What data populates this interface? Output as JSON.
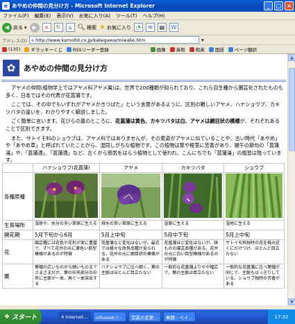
{
  "window": {
    "title": "あやめの仲間の見分け方 - Microsoft Internet Explorer"
  },
  "menu": [
    "ファイル(F)",
    "編集(E)",
    "表示(V)",
    "お気に入り(A)",
    "ツール(T)",
    "ヘルプ(H)"
  ],
  "toolbar": {
    "back": "戻る",
    "search": "検索",
    "favorites": "お気に入り"
  },
  "address": {
    "label": "アドレス(D)",
    "url": "http://www.kamoltd.co.jp/kakegawa/miwake.htm"
  },
  "links": [
    {
      "label": "(135)",
      "color": "#c23434"
    },
    {
      "label": "ギラッキーくじ",
      "color": "#e6a51a"
    },
    {
      "label": "RSSリーダー登録",
      "color": "#3e7ed6"
    },
    {
      "label": "画像",
      "color": "#4d8d3a"
    },
    {
      "label": "英和",
      "color": "#c23434"
    },
    {
      "label": "和英",
      "color": "#c23434"
    },
    {
      "label": "国語",
      "color": "#3e7ed6"
    },
    {
      "label": "ページ翻訳",
      "color": "#3e7ed6"
    }
  ],
  "page": {
    "title": "あやめの仲間の見分け方",
    "p1": "アヤメの仲間(植物学上ではアヤメ科アヤメ属)は、世界で200種類が知られており、これら自生種から園芸化されたものも多く、日本ではその代表が花菖蒲です。",
    "p2": "ここでは、その中でもいずれがアヤメかきつばた」という言葉があるように、区別の難しいアヤメ、ハナショウブ、カキツバタの違いを、わかりやすく解説しました。",
    "p3a": "ごく簡単に言います。花びらの基のところに、",
    "p3b": "花菖蒲は黄色、カキツバタは白、アヤメは網目状の模様",
    "p3c": "が、それぞれあることで区別できます。",
    "p4": "また、サトイモ科のショウブは、アヤメ科ではありませんが、その葉姿がアヤメに似ていることや、古い時代「あやめ」や「あやめ草」と呼ばれていたことから、混同しがちな植物です。この植物は葉や根茎に芳香があり、端午の節句の「菖蒲湯」や、「菖蒲酒」、「菖蒲酒」など、古くから邪気をはらう植物として使われ、こんにちでも「菖蒲湯」の風習は残っています。"
  },
  "table": {
    "headers": [
      "ハナショウブ(花菖蒲)",
      "アヤメ",
      "カキツバタ",
      "ショウブ"
    ],
    "rows": [
      {
        "label": "各種原種"
      },
      {
        "label": "生育場所",
        "cells": [
          "湿原や、水分の多い草原に生える",
          "排水の良い草原に生える",
          "湿原に生える",
          "湿地に生える"
        ]
      },
      {
        "label": "開花期",
        "cells": [
          "5月下旬から6月",
          "5月上中旬",
          "5月中下旬",
          "5月上中旬"
        ]
      },
      {
        "label": "花",
        "cells": [
          "園芸種には花色や花形が実に豊富で、すべて花弁の元に黄色い目型模様があるのが特徴",
          "花菖蒲など変化はないが、最近では様々な改良品種が見られる。花弁の元に網目状の模様がある",
          "花菖蒲ほど変化はないが、鉢ものの園芸品種がある。花弁の元に白い目型模様があるのが特徴",
          "サトイモ科独特の花を株元近くにだけつけ、ほとんど目立たない"
        ]
      },
      {
        "label": "葉",
        "cells": [
          "葉幅の広いものから細いものまでさまざまだが、葉の中央部分の中央に主脈が一本、高く一本突出する",
          "ハナショウブに比べ細く、葉の主脈はほとんど目立たない",
          "一般的な花菖蒲よりやや幅広で、葉の主脈は目立たない",
          "一般的な花菖蒲に比べ葉幅が同じで、主脈もはっきりしている。ショウブ独特の芳香がある"
        ]
      }
    ]
  },
  "taskbar": {
    "start": "スタート",
    "tasks": [
      "4 Internet…",
      "infoseekツ…",
      "営業の変更…",
      "無題 - ペイ…"
    ],
    "clock": "17:32"
  }
}
